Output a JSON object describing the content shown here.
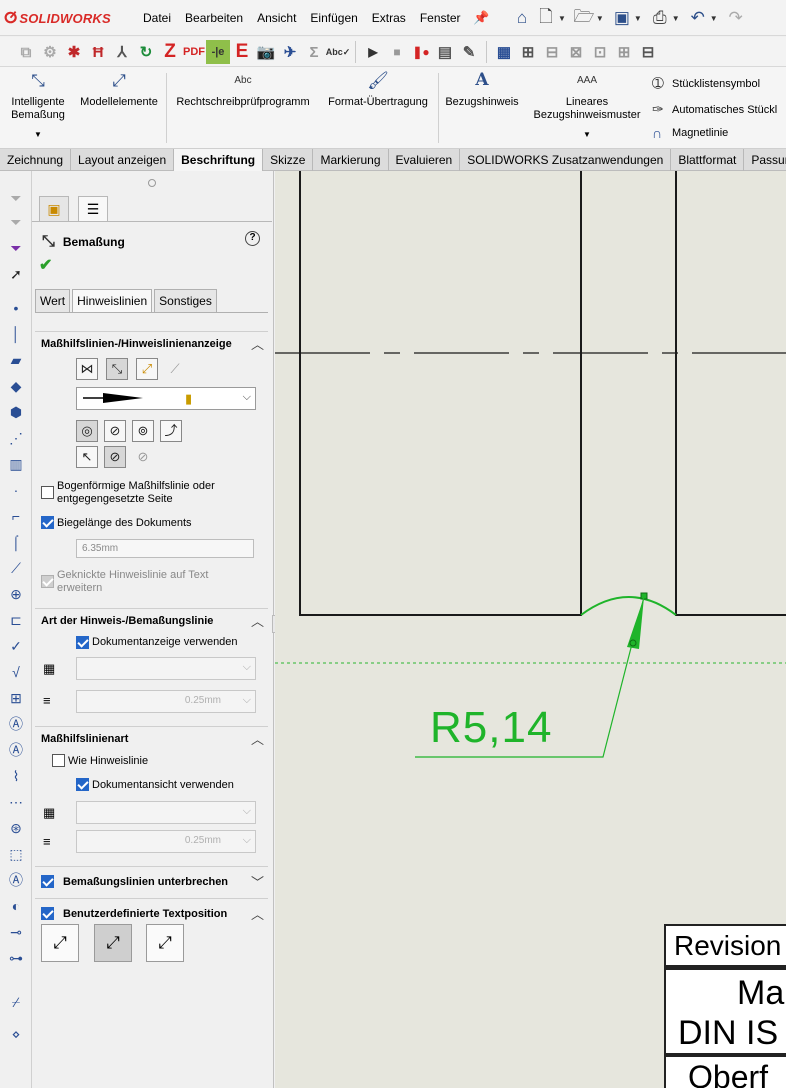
{
  "app": {
    "logo_text": "SOLIDWORKS",
    "menus": [
      "Datei",
      "Bearbeiten",
      "Ansicht",
      "Einfügen",
      "Extras",
      "Fenster"
    ]
  },
  "icons": {
    "quick_access": [
      "home-icon",
      "new-file-icon",
      "open-file-icon",
      "save-icon",
      "print-icon",
      "undo-icon",
      "redo-icon"
    ],
    "toolbar2": [
      "reference-icon",
      "macro-icon",
      "z-icon",
      "pdf-icon",
      "e-icon",
      "camera-icon",
      "sum-icon",
      "spell-icon",
      "play-icon",
      "stop-icon",
      "record-icon"
    ]
  },
  "ribbon": {
    "smart_dimension": "Intelligente Bemaßung",
    "model_items": "Modellelemente",
    "spell_check": "Rechtschreibprüfprogramm",
    "format_painter": "Format-Übertragung",
    "note": "Bezugshinweis",
    "linear_note_pattern": "Lineares Bezugshinweismuster",
    "balloon": "Stücklistensymbol",
    "auto_balloon": "Automatisches Stückl",
    "magnetic_line": "Magnetlinie"
  },
  "tabs": [
    {
      "label": "Zeichnung",
      "active": false
    },
    {
      "label": "Layout anzeigen",
      "active": false
    },
    {
      "label": "Beschriftung",
      "active": true
    },
    {
      "label": "Skizze",
      "active": false
    },
    {
      "label": "Markierung",
      "active": false
    },
    {
      "label": "Evaluieren",
      "active": false
    },
    {
      "label": "SOLIDWORKS Zusatzanwendungen",
      "active": false
    },
    {
      "label": "Blattformat",
      "active": false
    },
    {
      "label": "Passun",
      "active": false
    }
  ],
  "panel": {
    "title": "Bemaßung",
    "help": "?",
    "subtabs": [
      "Wert",
      "Hinweislinien",
      "Sonstiges"
    ],
    "active_subtab": "Hinweislinien",
    "section1": {
      "title": "Maßhilfslinien-/Hinweislinienanzeige",
      "arc_ext_label": "Bogenförmige Maßhilfslinie oder entgegengesetzte Seite",
      "arc_ext_checked": false,
      "bend_length_label": "Biegelänge des Dokuments",
      "bend_length_checked": true,
      "bend_length_value": "6.35mm",
      "jog_label": "Geknickte Hinweislinie auf Text erweitern",
      "jog_checked": true
    },
    "section2": {
      "title": "Art der Hinweis-/Bemaßungslinie",
      "use_doc_display_label": "Dokumentanzeige verwenden",
      "use_doc_display_checked": true,
      "thickness_value": "0.25mm"
    },
    "section3": {
      "title": "Maßhilfslinienart",
      "same_as_leader_label": "Wie Hinweislinie",
      "same_as_leader_checked": false,
      "use_doc_view_label": "Dokumentansicht verwenden",
      "use_doc_view_checked": true,
      "thickness_value": "0.25mm"
    },
    "section4": {
      "title": "Bemaßungslinien unterbrechen",
      "checked": true
    },
    "section5": {
      "title": "Benutzerdefinierte Textposition",
      "checked": true
    }
  },
  "drawing": {
    "dimension_text": "R5,14",
    "title_block": {
      "revision": "Revision",
      "material_partial": "Ma",
      "standard_partial": "DIN IS",
      "surface_partial": "Oberf"
    },
    "colors": {
      "background": "#e6e6dd",
      "geometry": "#1a1a1a",
      "dimension": "#1fb42a"
    }
  }
}
